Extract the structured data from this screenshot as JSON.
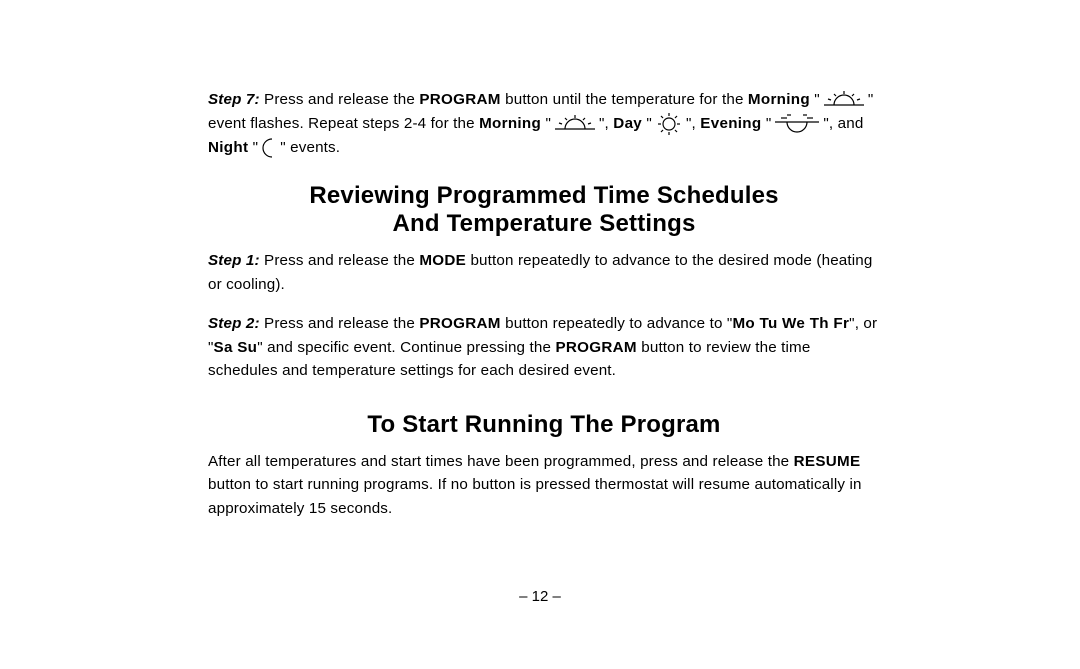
{
  "step7": {
    "label": "Step 7:",
    "t1": " Press and release the ",
    "program": "PROGRAM",
    "t2": " button until the temperature for the ",
    "morning1": "Morning",
    "t3": " \"",
    "t4": "\" event flashes. Repeat steps 2-4 for the ",
    "morning2": "Morning",
    "t5": " \"",
    "t6": "\", ",
    "day": "Day",
    "t7": " \"",
    "t8": "\", ",
    "evening": "Evening",
    "t9": " \"",
    "t10": "\", and ",
    "night": "Night",
    "t11": " \"",
    "t12": "\" events."
  },
  "heading1_line1": "Reviewing Programmed Time Schedules",
  "heading1_line2": "And Temperature Settings",
  "review_step1": {
    "label": "Step 1:",
    "t1": " Press and release the ",
    "mode": "MODE",
    "t2": " button repeatedly to advance to the desired mode (heating or cooling)."
  },
  "review_step2": {
    "label": "Step 2:",
    "t1": " Press and release the ",
    "program": "PROGRAM",
    "t2": " button repeatedly to advance to \"",
    "weekdays": "Mo Tu We Th Fr",
    "t3": "\", or \"",
    "weekend": "Sa Su",
    "t4": "\" and specific event. Continue pressing the ",
    "program2": "PROGRAM",
    "t5": " button to review the time schedules and temperature settings for each desired event."
  },
  "heading2": "To Start Running The Program",
  "start_para": {
    "t1": "After all temperatures and start times have been programmed, press and release the ",
    "resume": "RESUME",
    "t2": " button to start running programs. If no button is pressed thermostat will resume automatically in approximately 15 seconds."
  },
  "page_number": "– 12 –"
}
